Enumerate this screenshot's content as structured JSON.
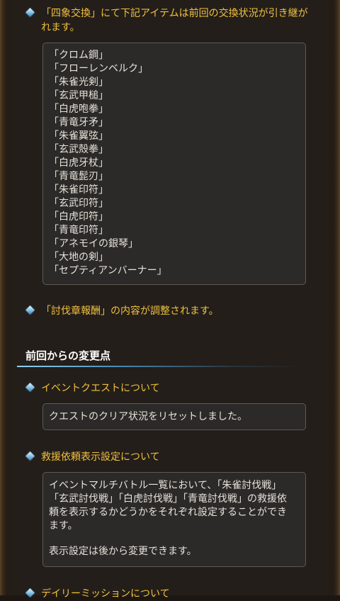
{
  "notice_exchange": {
    "text": "「四象交換」にて下記アイテムは前回の交換状況が引き継がれます。",
    "items": [
      "「クロム鋼」",
      "「フローレンベルク」",
      "「朱雀光剣」",
      "「玄武甲槌」",
      "「白虎咆拳」",
      "「青竜牙矛」",
      "「朱雀翼弦」",
      "「玄武殻拳」",
      "「白虎牙杖」",
      "「青竜髭刃」",
      "「朱雀印符」",
      "「玄武印符」",
      "「白虎印符」",
      "「青竜印符」",
      "「アネモイの銀琴」",
      "「大地の剣」",
      "「セプティアンバーナー」"
    ]
  },
  "notice_reward": {
    "text": "「討伐章報酬」の内容が調整されます。"
  },
  "section": {
    "title": "前回からの変更点"
  },
  "event_quest": {
    "heading": "イベントクエストについて",
    "body": "クエストのクリア状況をリセットしました。"
  },
  "rescue": {
    "heading": "救援依頼表示設定について",
    "body_lines": [
      "イベントマルチバトル一覧において、「朱雀討伐戦」",
      "「玄武討伐戦」「白虎討伐戦」「青竜討伐戦」の救援依",
      "頼を表示するかどうかをそれぞれ設定することができ",
      "ます。"
    ],
    "note": "表示設定は後から変更できます。"
  },
  "daily": {
    "heading": "デイリーミッションについて"
  }
}
